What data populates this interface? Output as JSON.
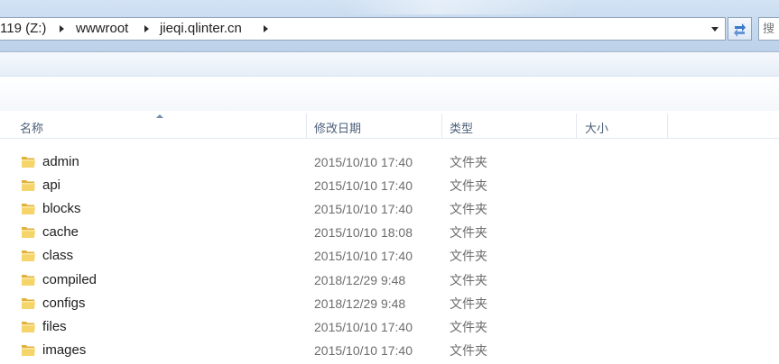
{
  "address_bar": {
    "breadcrumbs": [
      "119 (Z:)",
      "wwwroot",
      "jieqi.qlinter.cn"
    ],
    "search_placeholder": "搜"
  },
  "columns": {
    "name": "名称",
    "modified": "修改日期",
    "type": "类型",
    "size": "大小"
  },
  "files": [
    {
      "name": "admin",
      "modified": "2015/10/10 17:40",
      "type": "文件夹"
    },
    {
      "name": "api",
      "modified": "2015/10/10 17:40",
      "type": "文件夹"
    },
    {
      "name": "blocks",
      "modified": "2015/10/10 17:40",
      "type": "文件夹"
    },
    {
      "name": "cache",
      "modified": "2015/10/10 18:08",
      "type": "文件夹"
    },
    {
      "name": "class",
      "modified": "2015/10/10 17:40",
      "type": "文件夹"
    },
    {
      "name": "compiled",
      "modified": "2018/12/29 9:48",
      "type": "文件夹"
    },
    {
      "name": "configs",
      "modified": "2018/12/29 9:48",
      "type": "文件夹"
    },
    {
      "name": "files",
      "modified": "2015/10/10 17:40",
      "type": "文件夹"
    },
    {
      "name": "images",
      "modified": "2015/10/10 17:40",
      "type": "文件夹"
    }
  ],
  "icons": {
    "folder": "folder-icon",
    "refresh": "refresh-icon",
    "dropdown": "chevron-down-icon",
    "sort": "sort-ascending-icon"
  },
  "colors": {
    "header_text": "#4c607a",
    "folder_yellow": "#f2cf5b",
    "secondary_text": "#6d6d6d"
  }
}
